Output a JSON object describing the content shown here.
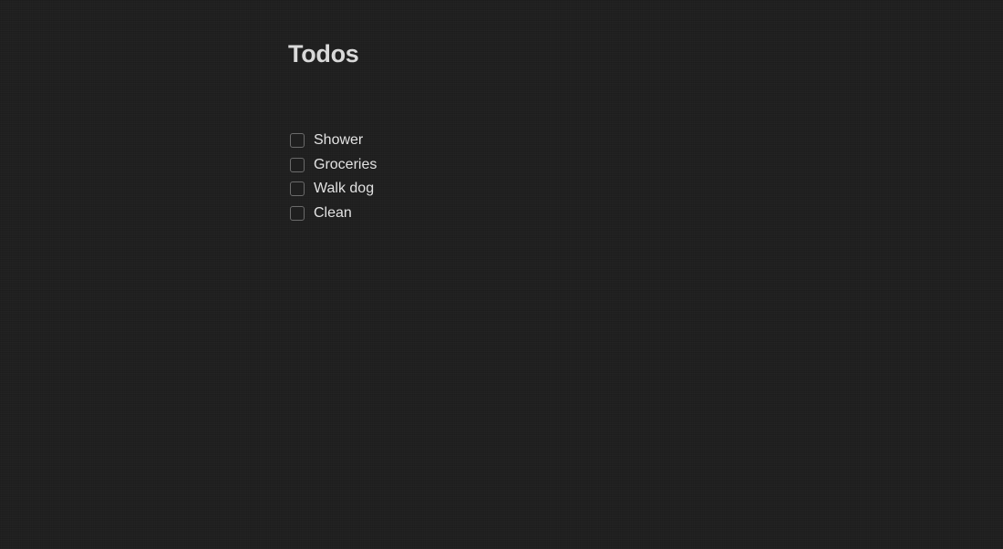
{
  "page": {
    "title": "Todos"
  },
  "todos": {
    "items": [
      {
        "label": "Shower",
        "checked": false
      },
      {
        "label": "Groceries",
        "checked": false
      },
      {
        "label": "Walk dog",
        "checked": false
      },
      {
        "label": "Clean",
        "checked": false
      }
    ]
  },
  "colors": {
    "background": "#1f1f1f",
    "text": "#e2e2e2",
    "checkbox_border": "#6b6b6b"
  }
}
